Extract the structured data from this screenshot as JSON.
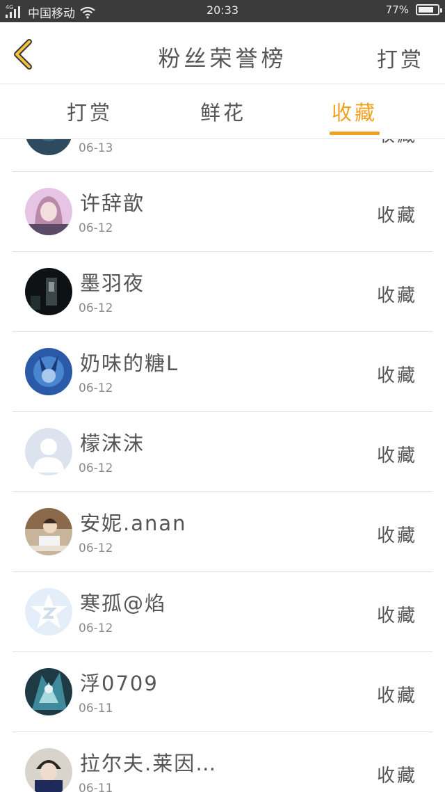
{
  "status_bar": {
    "network": "4G",
    "carrier": "中国移动",
    "time": "20:33",
    "battery": "77%"
  },
  "header": {
    "title": "粉丝荣誉榜",
    "action_label": "打赏"
  },
  "tabs": [
    {
      "label": "打赏",
      "active": false
    },
    {
      "label": "鲜花",
      "active": false
    },
    {
      "label": "收藏",
      "active": true
    }
  ],
  "colors": {
    "accent": "#f0a020",
    "status_bar_bg": "#3b3b3b",
    "text": "#555555",
    "divider": "#e2e2e2"
  },
  "list": {
    "partial_top_row": {
      "date": "06-13",
      "action": "收藏"
    },
    "rows": [
      {
        "name": "许辞歆",
        "date": "06-12",
        "action": "收藏",
        "avatar": "avatar-girl-pink"
      },
      {
        "name": "墨羽夜",
        "date": "06-12",
        "action": "收藏",
        "avatar": "avatar-dark-figure"
      },
      {
        "name": "奶味的糖L",
        "date": "06-12",
        "action": "收藏",
        "avatar": "avatar-blue-anime"
      },
      {
        "name": "檬沫沫",
        "date": "06-12",
        "action": "收藏",
        "avatar": "avatar-default-person"
      },
      {
        "name": "安妮.anan",
        "date": "06-12",
        "action": "收藏",
        "avatar": "avatar-boy-reading"
      },
      {
        "name": "寒孤@焰",
        "date": "06-12",
        "action": "收藏",
        "avatar": "avatar-qq-star"
      },
      {
        "name": "浮0709",
        "date": "06-11",
        "action": "收藏",
        "avatar": "avatar-teal-anime"
      },
      {
        "name": "拉尔夫.莱因…",
        "date": "06-11",
        "action": "收藏",
        "avatar": "avatar-anime-boy"
      }
    ]
  }
}
